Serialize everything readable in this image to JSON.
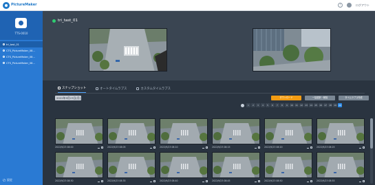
{
  "topbar": {
    "brand": "PictureMaker",
    "logout": "ログアウト"
  },
  "sidebar": {
    "subtitle": "TTS-0010",
    "items": [
      {
        "label": "tri_tast_01",
        "active": true
      },
      {
        "label": "CTS_PictureMaker_08...",
        "active": false
      },
      {
        "label": "CTS_PictureMaker_08...",
        "active": false
      },
      {
        "label": "CTS_PictureMaker_08...",
        "active": false
      }
    ],
    "settings": "設定"
  },
  "camera": {
    "name": "tri_tast_01",
    "status_color": "#2ecc71"
  },
  "tabs": [
    {
      "label": "スナップショット",
      "active": true
    },
    {
      "label": "オートタイムラプス",
      "active": false
    },
    {
      "label": "カスタムタイムラプス",
      "active": false
    }
  ],
  "controls": {
    "date_value": "2022年9月23日(月)",
    "download_label": "ダウンロード",
    "bulk_label": "一括選択・削除",
    "timelapse_label": "タイムラプス作成"
  },
  "pager": {
    "pages": [
      "1",
      "2",
      "3",
      "4",
      "5",
      "6",
      "7",
      "8",
      "9",
      "10",
      "11",
      "12",
      "13",
      "14",
      "15",
      "16",
      "17",
      "18",
      "19",
      "20"
    ],
    "active_index": 19
  },
  "thumbnails": [
    {
      "time": "2022/9/23 08:00"
    },
    {
      "time": "2022/9/23 08:05"
    },
    {
      "time": "2022/9/23 08:10"
    },
    {
      "time": "2022/9/23 08:15"
    },
    {
      "time": "2022/9/23 08:20"
    },
    {
      "time": "2022/9/23 08:25"
    },
    {
      "time": "2022/9/23 08:30"
    },
    {
      "time": "2022/9/23 08:35"
    },
    {
      "time": "2022/9/23 08:40"
    },
    {
      "time": "2022/9/23 08:45"
    },
    {
      "time": "2022/9/23 08:50"
    },
    {
      "time": "2022/9/23 08:55"
    }
  ],
  "colors": {
    "accent": "#2d8ae6",
    "sidebar": "#2a7ad3",
    "download": "#f39c12"
  }
}
